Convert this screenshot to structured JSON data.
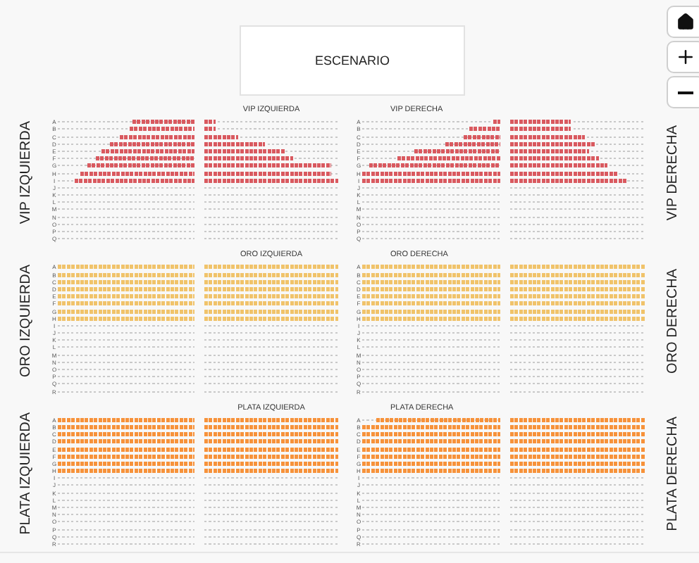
{
  "stage": {
    "label": "ESCENARIO"
  },
  "sections": [
    {
      "side_left": "VIP IZQUIERDA",
      "side_right": "VIP DERECHA",
      "title_left": "VIP IZQUIERDA",
      "title_right": "VIP DERECHA",
      "color": "#d9595f",
      "rows": [
        {
          "label_left": "A",
          "label_right": "A",
          "blocks": [
            {
              "level": 0.45
            },
            {
              "level": 0.08
            },
            {
              "level": 0.05
            },
            {
              "level": 0.45
            }
          ]
        },
        {
          "label_left": "B",
          "label_right": "B",
          "blocks": [
            {
              "level": 0.47
            },
            {
              "level": 0.08
            },
            {
              "level": 0.22
            },
            {
              "level": 0.45
            }
          ]
        },
        {
          "label_left": "C",
          "label_right": "C",
          "blocks": [
            {
              "level": 0.55
            },
            {
              "level": 0.25
            },
            {
              "level": 0.27
            },
            {
              "level": 0.55
            }
          ]
        },
        {
          "label_left": "D",
          "label_right": "D",
          "blocks": [
            {
              "level": 0.62
            },
            {
              "level": 0.45
            },
            {
              "level": 0.4
            },
            {
              "level": 0.62
            }
          ]
        },
        {
          "label_left": "E",
          "label_right": "E",
          "blocks": [
            {
              "level": 0.68
            },
            {
              "level": 0.6
            },
            {
              "level": 0.62
            },
            {
              "level": 0.58
            }
          ]
        },
        {
          "label_left": "F",
          "label_right": "F",
          "blocks": [
            {
              "level": 0.72
            },
            {
              "level": 0.66
            },
            {
              "level": 0.75
            },
            {
              "level": 0.66
            }
          ]
        },
        {
          "label_left": "G",
          "label_right": "G",
          "blocks": [
            {
              "level": 0.78
            },
            {
              "level": 0.95
            },
            {
              "level": 0.95
            },
            {
              "level": 0.72
            }
          ]
        },
        {
          "label_left": "H",
          "label_right": "H",
          "blocks": [
            {
              "level": 0.84
            },
            {
              "level": 0.95
            },
            {
              "level": 1
            },
            {
              "level": 0.8
            }
          ]
        },
        {
          "label_left": "I",
          "label_right": "I",
          "blocks": [
            {
              "level": 0.88
            },
            {
              "level": 1
            },
            {
              "level": 1
            },
            {
              "level": 0.86
            }
          ]
        },
        {
          "label_left": "J",
          "label_right": "J"
        },
        {
          "label_left": "K",
          "label_right": "K"
        },
        {
          "label_left": "L",
          "label_right": "L"
        },
        {
          "label_left": "M",
          "label_right": "M"
        },
        {
          "label_left": "N",
          "label_right": "N"
        },
        {
          "label_left": "O",
          "label_right": "O"
        },
        {
          "label_left": "P",
          "label_right": "P"
        },
        {
          "label_left": "Q",
          "label_right": "Q"
        }
      ]
    },
    {
      "side_left": "ORO IZQUIERDA",
      "side_right": "ORO DERECHA",
      "title_left": "ORO IZQUIERDA",
      "title_right": "ORO DERECHA",
      "color": "#f0c36a",
      "rows": [
        {
          "label_left": "A",
          "label_right": "A",
          "blocks": [
            {
              "level": 1
            },
            {
              "level": 1
            },
            {
              "level": 1
            },
            {
              "level": 1
            }
          ]
        },
        {
          "label_left": "B",
          "label_right": "B",
          "blocks": [
            {
              "level": 1
            },
            {
              "level": 1
            },
            {
              "level": 1
            },
            {
              "level": 1
            }
          ]
        },
        {
          "label_left": "C",
          "label_right": "C",
          "blocks": [
            {
              "level": 1
            },
            {
              "level": 1
            },
            {
              "level": 1
            },
            {
              "level": 1
            }
          ]
        },
        {
          "label_left": "D",
          "label_right": "D",
          "blocks": [
            {
              "level": 1
            },
            {
              "level": 1
            },
            {
              "level": 1
            },
            {
              "level": 1
            }
          ]
        },
        {
          "label_left": "E",
          "label_right": "E",
          "blocks": [
            {
              "level": 1
            },
            {
              "level": 1
            },
            {
              "level": 1
            },
            {
              "level": 1
            }
          ]
        },
        {
          "label_left": "F",
          "label_right": "F",
          "blocks": [
            {
              "level": 1
            },
            {
              "level": 1
            },
            {
              "level": 1
            },
            {
              "level": 1
            }
          ]
        },
        {
          "label_left": "G",
          "label_right": "G",
          "blocks": [
            {
              "level": 1
            },
            {
              "level": 1
            },
            {
              "level": 1
            },
            {
              "level": 1
            }
          ]
        },
        {
          "label_left": "H",
          "label_right": "H",
          "blocks": [
            {
              "level": 1
            },
            {
              "level": 1
            },
            {
              "level": 1
            },
            {
              "level": 1
            }
          ]
        },
        {
          "label_left": "I",
          "label_right": "I"
        },
        {
          "label_left": "J",
          "label_right": "J"
        },
        {
          "label_left": "K",
          "label_right": "K"
        },
        {
          "label_left": "L",
          "label_right": "L"
        },
        {
          "label_left": "M",
          "label_right": "M"
        },
        {
          "label_left": "N",
          "label_right": "N"
        },
        {
          "label_left": "O",
          "label_right": "O"
        },
        {
          "label_left": "P",
          "label_right": "P"
        },
        {
          "label_left": "Q",
          "label_right": "Q"
        },
        {
          "label_left": "R",
          "label_right": "R"
        }
      ]
    },
    {
      "side_left": "PLATA IZQUIERDA",
      "side_right": "PLATA DERECHA",
      "title_left": "PLATA IZQUIERDA",
      "title_right": "PLATA DERECHA",
      "color": "#f7923a",
      "rows": [
        {
          "label_left": "A",
          "label_right": "A",
          "blocks": [
            {
              "level": 1
            },
            {
              "level": 1
            },
            {
              "level": 0.9
            },
            {
              "level": 1
            }
          ]
        },
        {
          "label_left": "B",
          "label_right": "B",
          "blocks": [
            {
              "level": 1
            },
            {
              "level": 1
            },
            {
              "level": 1
            },
            {
              "level": 1
            }
          ]
        },
        {
          "label_left": "C",
          "label_right": "C",
          "blocks": [
            {
              "level": 1
            },
            {
              "level": 1
            },
            {
              "level": 1
            },
            {
              "level": 1
            }
          ]
        },
        {
          "label_left": "D",
          "label_right": "D",
          "blocks": [
            {
              "level": 1
            },
            {
              "level": 1
            },
            {
              "level": 1
            },
            {
              "level": 1
            }
          ]
        },
        {
          "label_left": "E",
          "label_right": "E",
          "blocks": [
            {
              "level": 1
            },
            {
              "level": 1
            },
            {
              "level": 1
            },
            {
              "level": 1
            }
          ]
        },
        {
          "label_left": "F",
          "label_right": "F",
          "blocks": [
            {
              "level": 1
            },
            {
              "level": 1
            },
            {
              "level": 1
            },
            {
              "level": 1
            }
          ]
        },
        {
          "label_left": "G",
          "label_right": "G",
          "blocks": [
            {
              "level": 1
            },
            {
              "level": 1
            },
            {
              "level": 1
            },
            {
              "level": 1
            }
          ]
        },
        {
          "label_left": "H",
          "label_right": "H",
          "blocks": [
            {
              "level": 1
            },
            {
              "level": 1
            },
            {
              "level": 1
            },
            {
              "level": 1
            }
          ]
        },
        {
          "label_left": "I",
          "label_right": "I"
        },
        {
          "label_left": "J",
          "label_right": "J"
        },
        {
          "label_left": "K",
          "label_right": "K"
        },
        {
          "label_left": "L",
          "label_right": "L"
        },
        {
          "label_left": "M",
          "label_right": "M"
        },
        {
          "label_left": "N",
          "label_right": "N"
        },
        {
          "label_left": "O",
          "label_right": "O"
        },
        {
          "label_left": "P",
          "label_right": "P"
        },
        {
          "label_left": "Q",
          "label_right": "Q"
        },
        {
          "label_left": "R",
          "label_right": "R"
        }
      ]
    }
  ]
}
